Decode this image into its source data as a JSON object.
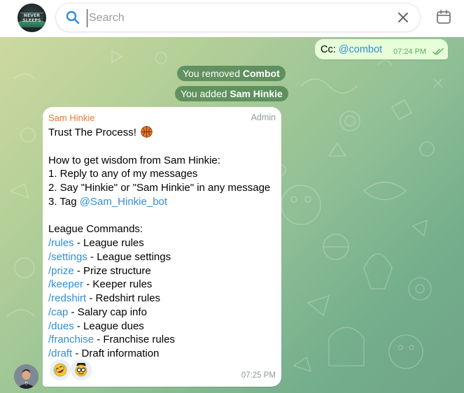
{
  "header": {
    "search_placeholder": "Search",
    "search_value": "",
    "avatar_name": "NEVER SLEEPS",
    "icons": [
      "search-icon",
      "close-icon",
      "calendar-icon"
    ]
  },
  "outgoing_message": {
    "prefix": "Cc: ",
    "mention": "@combot",
    "time": "07:24 PM",
    "status": "read-double-check-icon"
  },
  "service_messages": [
    {
      "text": "You removed ",
      "bold": "Combot"
    },
    {
      "text": "You added ",
      "bold": "Sam Hinkie"
    }
  ],
  "incoming_message": {
    "sender": "Sam Hinkie",
    "role": "Admin",
    "title": "Trust The Process!",
    "title_emoji": "basketball",
    "intro": "How to get wisdom from Sam Hinkie:",
    "steps": [
      "1. Reply to any of my messages",
      "2. Say \"Hinkie\" or \"Sam Hinkie\" in any message"
    ],
    "step3_prefix": "3. Tag ",
    "step3_mention": "@Sam_Hinkie_bot",
    "commands_heading": "League Commands:",
    "commands": [
      {
        "cmd": "/rules",
        "desc": " - League rules"
      },
      {
        "cmd": "/settings",
        "desc": " - League settings"
      },
      {
        "cmd": "/prize",
        "desc": " - Prize structure"
      },
      {
        "cmd": "/keeper",
        "desc": " - Keeper rules"
      },
      {
        "cmd": "/redshirt",
        "desc": " - Redshirt rules"
      },
      {
        "cmd": "/cap",
        "desc": " - Salary cap info"
      },
      {
        "cmd": "/dues",
        "desc": " - League dues"
      },
      {
        "cmd": "/franchise",
        "desc": " - Franchise rules"
      },
      {
        "cmd": "/draft",
        "desc": " - Draft information"
      }
    ],
    "reactions": [
      "rofl-emoji",
      "nerd-emoji"
    ],
    "time": "07:25 PM"
  },
  "colors": {
    "accent_blue": "#2f8ed8",
    "sender_orange": "#e7782f",
    "outgoing_bubble": "#e7ffd9",
    "service_pill": "#4a804e"
  }
}
